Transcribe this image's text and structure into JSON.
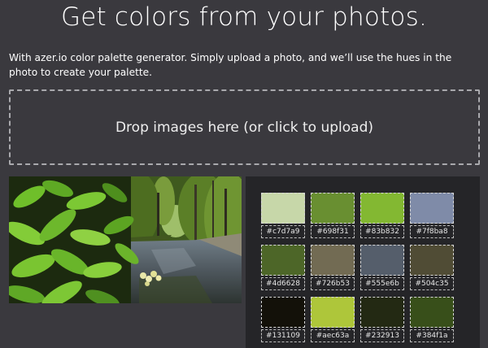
{
  "header": {
    "title": "Get colors from your photos."
  },
  "intro": {
    "text": "With azer.io color palette generator. Simply upload a photo, and we’ll use the hues in the photo to create your palette."
  },
  "dropzone": {
    "label": "Drop images here (or click to upload)"
  },
  "palette": {
    "swatches": [
      {
        "hex": "#c7d7a9",
        "color": "#c7d7a9"
      },
      {
        "hex": "#698f31",
        "color": "#698f31"
      },
      {
        "hex": "#83b832",
        "color": "#83b832"
      },
      {
        "hex": "#7f8ba8",
        "color": "#7f8ba8"
      },
      {
        "hex": "#4d6628",
        "color": "#4d6628"
      },
      {
        "hex": "#726b53",
        "color": "#726b53"
      },
      {
        "hex": "#555e6b",
        "color": "#555e6b"
      },
      {
        "hex": "#504c35",
        "color": "#504c35"
      },
      {
        "hex": "#131109",
        "color": "#131109"
      },
      {
        "hex": "#aec63a",
        "color": "#aec63a"
      },
      {
        "hex": "#232913",
        "color": "#232913"
      },
      {
        "hex": "#384f1a",
        "color": "#384f1a"
      }
    ]
  }
}
